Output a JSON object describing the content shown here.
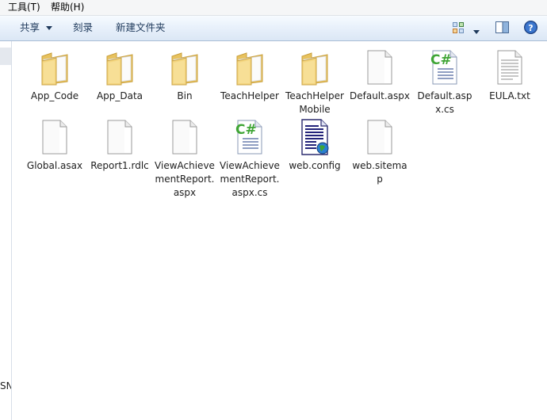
{
  "menu": {
    "tools": "工具(T)",
    "help": "帮助(H)"
  },
  "toolbar": {
    "share_label": "共享",
    "burn_label": "刻录",
    "new_folder_label": "新建文件夹"
  },
  "navpane": {
    "partial_text": "SN"
  },
  "files": [
    {
      "name": "App_Code",
      "icon": "folder-icon"
    },
    {
      "name": "App_Data",
      "icon": "folder-icon"
    },
    {
      "name": "Bin",
      "icon": "folder-icon"
    },
    {
      "name": "TeachHelper",
      "icon": "folder-icon"
    },
    {
      "name": "TeachHelperMobile",
      "icon": "folder-icon"
    },
    {
      "name": "Default.aspx",
      "icon": "blank-file-icon"
    },
    {
      "name": "Default.aspx.cs",
      "icon": "csharp-file-icon"
    },
    {
      "name": "EULA.txt",
      "icon": "text-file-icon"
    },
    {
      "name": "Global.asax",
      "icon": "blank-file-icon"
    },
    {
      "name": "Report1.rdlc",
      "icon": "blank-file-icon"
    },
    {
      "name": "ViewAchievementReport.aspx",
      "icon": "blank-file-icon"
    },
    {
      "name": "ViewAchievementReport.aspx.cs",
      "icon": "csharp-file-icon"
    },
    {
      "name": "web.config",
      "icon": "config-file-icon"
    },
    {
      "name": "web.sitemap",
      "icon": "blank-file-icon"
    }
  ],
  "colors": {
    "folder": "#f2d37a",
    "toolbar_text": "#1e395b",
    "csharp_green": "#3fa535"
  }
}
